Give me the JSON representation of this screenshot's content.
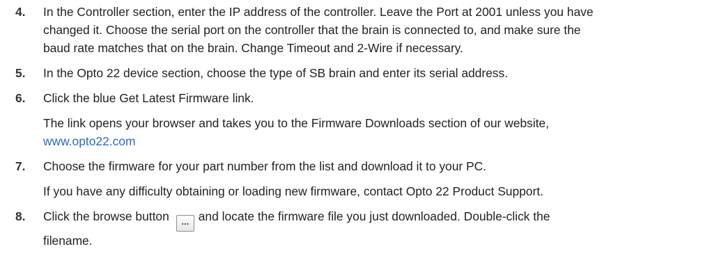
{
  "steps": [
    {
      "num": "4.",
      "lines": [
        "In the Controller section, enter the IP address of the controller. Leave the Port at 2001 unless you have",
        "changed it. Choose the serial port on the controller that the brain is connected to, and make sure the",
        "baud rate matches that on the brain. Change Timeout and 2-Wire if necessary."
      ]
    },
    {
      "num": "5.",
      "lines": [
        "In the Opto 22 device section, choose the type of SB brain and enter its serial address."
      ]
    },
    {
      "num": "6.",
      "lines": [
        "Click the blue Get Latest Firmware link."
      ],
      "sub_lines": [
        "The link opens your browser and takes you to the Firmware Downloads section of our website,"
      ],
      "link_text": "www.opto22.com"
    },
    {
      "num": "7.",
      "lines": [
        "Choose the firmware for your part number from the list and download it to your PC."
      ],
      "sub_lines": [
        "If you have any difficulty obtaining or loading new firmware, contact Opto 22 Product Support."
      ]
    },
    {
      "num": "8.",
      "before_button": "Click the browse button",
      "button_label": "...",
      "after_button": "and locate the firmware file you just downloaded. Double-click the",
      "lines": [
        "filename."
      ]
    }
  ]
}
